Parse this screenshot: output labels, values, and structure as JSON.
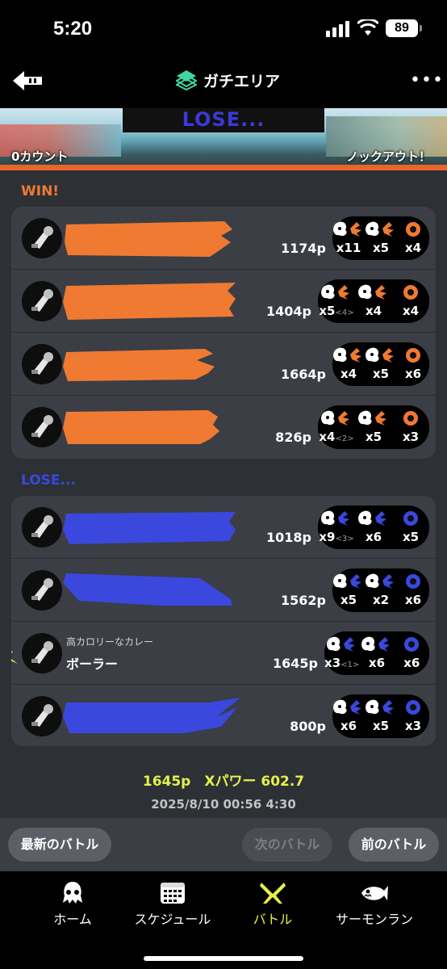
{
  "status_bar": {
    "time": "5:20",
    "battery": "89"
  },
  "header": {
    "mode": "ガチエリア"
  },
  "banner": {
    "result": "LOSE...",
    "left_text": "0カウント",
    "right_text": "ノックアウト！"
  },
  "teams": {
    "win_label": "WIN!",
    "lose_label": "LOSE...",
    "win_color": "#f07a32",
    "lose_color": "#3a48de"
  },
  "win_players": [
    {
      "weapon_icon": "axe-weapon-icon",
      "points": "1174p",
      "kills": "x11",
      "assists": "",
      "deaths": "x5",
      "specials": "x4",
      "special_icon": "zipcaster-icon"
    },
    {
      "weapon_icon": "splatling-weapon-icon",
      "points": "1404p",
      "kills": "x5",
      "assists": "<4>",
      "deaths": "x4",
      "specials": "x4",
      "special_icon": "rain-icon"
    },
    {
      "weapon_icon": "shooter-weapon-icon",
      "points": "1664p",
      "kills": "x4",
      "assists": "",
      "deaths": "x5",
      "specials": "x6",
      "special_icon": "crab-icon"
    },
    {
      "weapon_icon": "dualie-weapon-icon",
      "points": "826p",
      "kills": "x4",
      "assists": "<2>",
      "deaths": "x5",
      "specials": "x3",
      "special_icon": "crab-tank-icon"
    }
  ],
  "lose_players": [
    {
      "weapon_icon": "blaster-weapon-icon",
      "points": "1018p",
      "kills": "x9",
      "assists": "<3>",
      "deaths": "x6",
      "specials": "x5",
      "special_icon": "vortex-icon"
    },
    {
      "weapon_icon": "charger-weapon-icon",
      "points": "1562p",
      "kills": "x5",
      "assists": "",
      "deaths": "x2",
      "specials": "x6",
      "special_icon": "bubble-icon"
    },
    {
      "weapon_icon": "bow-weapon-icon",
      "points": "1645p",
      "kills": "x3",
      "assists": "<1>",
      "deaths": "x6",
      "specials": "x6",
      "special_icon": "bubble-icon",
      "title": "高カロリーなカレー",
      "name": "ボーラー",
      "self": true
    },
    {
      "weapon_icon": "roller-weapon-icon",
      "points": "800p",
      "kills": "x6",
      "assists": "",
      "deaths": "x5",
      "specials": "x3",
      "special_icon": "big-bubbler-icon"
    }
  ],
  "summary": {
    "result": "1645p　Xパワー 602.7",
    "datetime": "2025/8/10 00:56 4:30"
  },
  "pager": {
    "latest": "最新のバトル",
    "next": "次のバトル",
    "prev": "前のバトル"
  },
  "tabs": {
    "home": "ホーム",
    "schedule": "スケジュール",
    "battle": "バトル",
    "salmon": "サーモンラン"
  }
}
